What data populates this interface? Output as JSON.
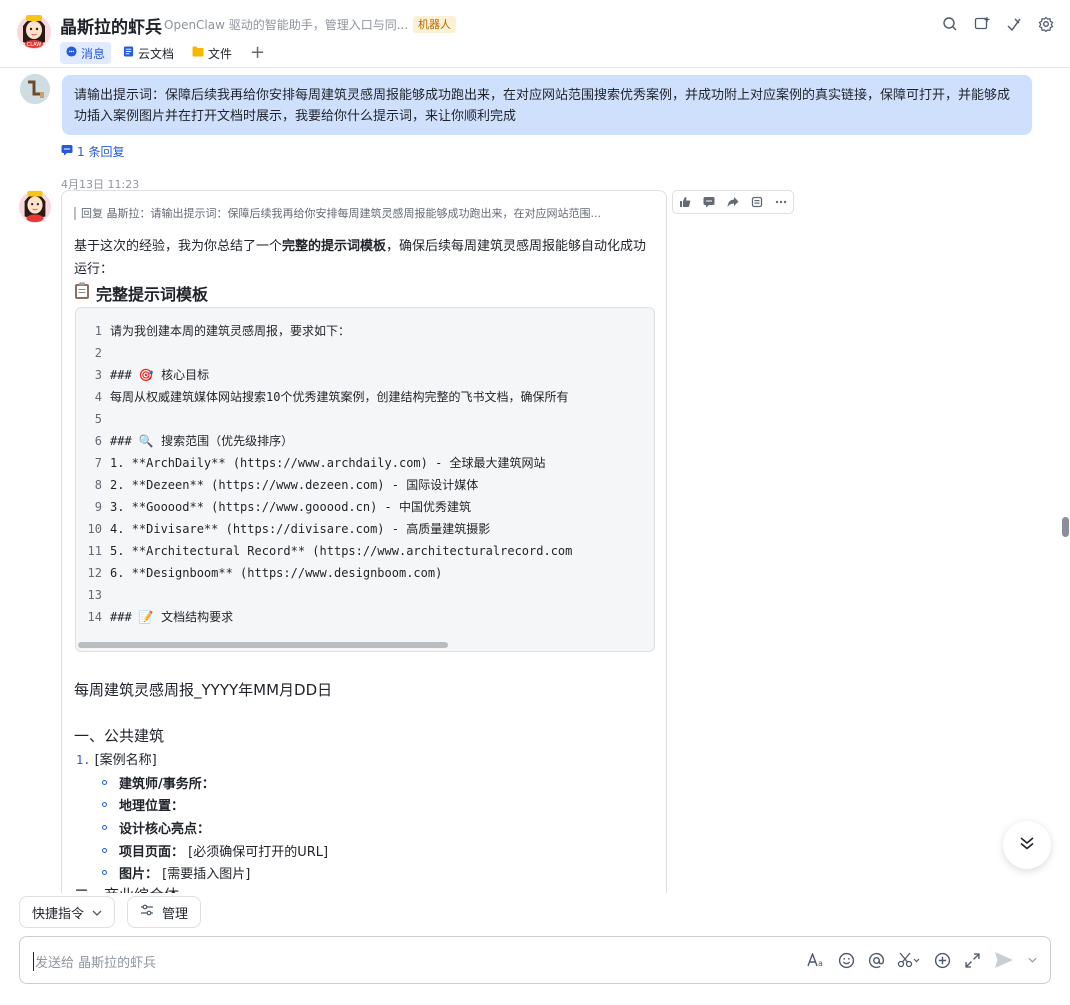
{
  "header": {
    "title": "晶斯拉的虾兵",
    "subtitle": "OpenClaw 驱动的智能助手，管理入口与同...",
    "bot_tag": "机器人",
    "tabs": [
      {
        "label": "消息",
        "icon": "chat-icon"
      },
      {
        "label": "云文档",
        "icon": "doc-icon"
      },
      {
        "label": "文件",
        "icon": "folder-icon"
      }
    ],
    "add_tab": "+"
  },
  "user_message": {
    "text": "请输出提示词：保障后续我再给你安排每周建筑灵感周报能够成功跑出来，在对应网站范围搜索优秀案例，并成功附上对应案例的真实链接，保障可打开，并能够成功插入案例图片并在打开文档时展示，我要给你什么提示词，来让你顺利完成",
    "reply_count": "1 条回复"
  },
  "timestamp": "4月13日 11:23",
  "bot_message": {
    "quote": "回复 晶斯拉：请输出提示词：保障后续我再给你安排每周建筑灵感周报能够成功跑出来，在对应网站范围...",
    "intro_1": "基于这次的经验，我为你总结了一个",
    "intro_bold": "完整的提示词模板",
    "intro_2": "，确保后续每周建筑灵感周报能够自动化成功运行：",
    "heading": "完整提示词模板",
    "code_lines": [
      {
        "n": "1",
        "t": "请为我创建本周的建筑灵感周报，要求如下："
      },
      {
        "n": "2",
        "t": ""
      },
      {
        "n": "3",
        "t": "### 🎯 核心目标"
      },
      {
        "n": "4",
        "t": "每周从权威建筑媒体网站搜索10个优秀建筑案例，创建结构完整的飞书文档，确保所有"
      },
      {
        "n": "5",
        "t": ""
      },
      {
        "n": "6",
        "t": "### 🔍 搜索范围（优先级排序）"
      },
      {
        "n": "7",
        "t": "1. **ArchDaily** (https://www.archdaily.com) - 全球最大建筑网站"
      },
      {
        "n": "8",
        "t": "2. **Dezeen** (https://www.dezeen.com) - 国际设计媒体"
      },
      {
        "n": "9",
        "t": "3. **Gooood** (https://www.gooood.cn) - 中国优秀建筑"
      },
      {
        "n": "10",
        "t": "4. **Divisare** (https://divisare.com) - 高质量建筑摄影"
      },
      {
        "n": "11",
        "t": "5. **Architectural Record** (https://www.architecturalrecord.com"
      },
      {
        "n": "12",
        "t": "6. **Designboom** (https://www.designboom.com)"
      },
      {
        "n": "13",
        "t": ""
      },
      {
        "n": "14",
        "t": "### 📝 文档结构要求"
      }
    ],
    "doc_title": "每周建筑灵感周报_YYYY年MM月DD日",
    "section_1": "一、公共建筑",
    "list_num": "1.",
    "list_item": "[案例名称]",
    "bullets": [
      {
        "label": "建筑师/事务所：",
        "value": ""
      },
      {
        "label": "地理位置：",
        "value": ""
      },
      {
        "label": "设计核心亮点：",
        "value": ""
      },
      {
        "label": "项目页面：",
        "value": "[必须确保可打开的URL]"
      },
      {
        "label": "图片：",
        "value": "[需要插入图片]"
      }
    ],
    "section_2": "二、商业综合体"
  },
  "bottom": {
    "quick_cmd": "快捷指令",
    "manage": "管理",
    "input_placeholder": "发送给 晶斯拉的虾兵"
  }
}
